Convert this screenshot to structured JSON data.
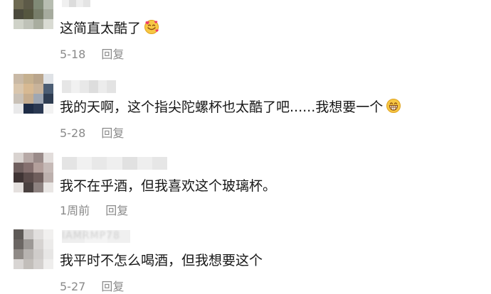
{
  "comments": [
    {
      "username": "",
      "text": "这简直太酷了",
      "emoji": "smiling-face-with-hearts",
      "date": "5-18",
      "reply_label": "回复",
      "avatar_colors": [
        "#9aa096",
        "#8d9186",
        "#6f7b6a",
        "#c5c9bf",
        "#6e6a52",
        "#5d5a48",
        "#808a76",
        "#b7bdb1",
        "#4b4a3c",
        "#55563f",
        "#777d69",
        "#a6ab9e",
        "#cfd2c8",
        "#bfc2b8",
        "#a9ad9f",
        "#d9dbd3"
      ],
      "username_colors": [
        "#e4e4e4",
        "#eeeeee",
        "#dcdcdc",
        "#f0f0f0"
      ]
    },
    {
      "username": "",
      "text": "我的天啊，这个指尖陀螺杯也太酷了吧......我想要一个",
      "emoji": "grinning-face",
      "date": "5-28",
      "reply_label": "回复",
      "avatar_colors": [
        "#c9b9a6",
        "#c5b08f",
        "#b9a58c",
        "#dfe2e6",
        "#d9c6ad",
        "#d7b992",
        "#c8b39b",
        "#4b5d74",
        "#c9c1b7",
        "#c6ad8f",
        "#9fa7b3",
        "#2f3d52",
        "#e9e9ea",
        "#1e2c46",
        "#2b3952",
        "#f2f2f2"
      ],
      "username_colors": [
        "#e3e3e3",
        "#ececec",
        "#dddddd",
        "#e8e8e8",
        "#f1f1f1",
        "#e6e6e6"
      ]
    },
    {
      "username": "",
      "text": "我不在乎酒，但我喜欢这个玻璃杯。",
      "emoji": "",
      "date": "1周前",
      "reply_label": "回复",
      "avatar_colors": [
        "#d9d3d0",
        "#b7a9a6",
        "#9a8b89",
        "#e2dddb",
        "#6f5f5e",
        "#85706f",
        "#b39f9b",
        "#c6bab7",
        "#3f3434",
        "#5a4b4a",
        "#6f5e5c",
        "#bcb0ad",
        "#e4e0de",
        "#4a4140",
        "#8d8280",
        "#e9e6e4"
      ],
      "username_colors": [
        "#e6e6e6",
        "#eeeeee",
        "#e1e1e1",
        "#efefef",
        "#e8e8e8",
        "#f1f1f1",
        "#e4e4e4"
      ]
    },
    {
      "username": "IAMRMP78",
      "text": "我平时不怎么喝酒，但我想要这个",
      "emoji": "",
      "date": "5-27",
      "reply_label": "回复",
      "avatar_colors": [
        "#5e5a57",
        "#c7c4c2",
        "#e1dfde",
        "#f1f0ef",
        "#6b6663",
        "#9c9895",
        "#d6d3d1",
        "#ecebea",
        "#8f8a86",
        "#b7b3b0",
        "#cfccca",
        "#e7e6e5",
        "#d8d5d3",
        "#c2beba",
        "#d4d1cf",
        "#efeeed"
      ],
      "username_colors": [
        "#f0f0f0",
        "#f4f4f4",
        "#eeeeee"
      ]
    }
  ]
}
